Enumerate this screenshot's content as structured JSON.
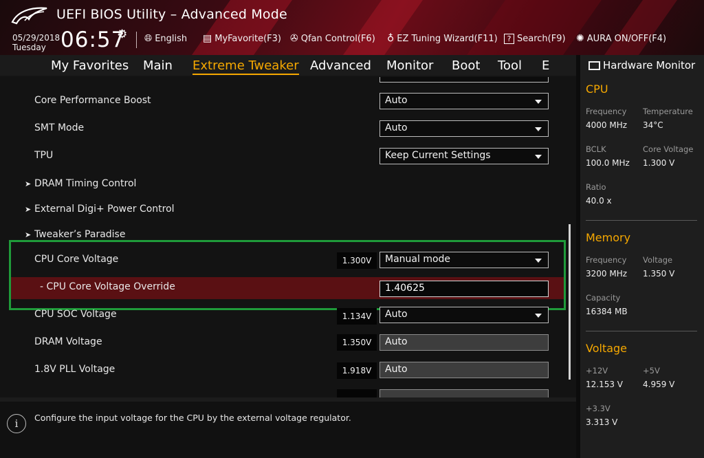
{
  "header": {
    "title": "UEFI BIOS Utility – Advanced Mode",
    "date": "05/29/2018",
    "day": "Tuesday",
    "time": "06:57",
    "tools": [
      {
        "label": "English",
        "icon": "globe-icon"
      },
      {
        "label": "MyFavorite(F3)",
        "icon": "favorite-icon"
      },
      {
        "label": "Qfan Control(F6)",
        "icon": "fan-icon"
      },
      {
        "label": "EZ Tuning Wizard(F11)",
        "icon": "bulb-icon"
      },
      {
        "label": "Search(F9)",
        "icon": "help-search-icon"
      },
      {
        "label": "AURA ON/OFF(F4)",
        "icon": "aura-icon"
      }
    ]
  },
  "nav": {
    "tabs": [
      "My Favorites",
      "Main",
      "Extreme Tweaker",
      "Advanced",
      "Monitor",
      "Boot",
      "Tool",
      "E"
    ],
    "active": "Extreme Tweaker"
  },
  "settings": {
    "core_performance_boost": {
      "label": "Core Performance Boost",
      "value": "Auto"
    },
    "smt_mode": {
      "label": "SMT Mode",
      "value": "Auto"
    },
    "tpu": {
      "label": "TPU",
      "value": "Keep Current Settings"
    },
    "dram_timing": {
      "label": "DRAM Timing Control"
    },
    "digi_power": {
      "label": "External Digi+ Power Control"
    },
    "tweakers_paradise": {
      "label": "Tweaker’s Paradise"
    },
    "cpu_core_voltage": {
      "label": "CPU Core Voltage",
      "reading": "1.300V",
      "value": "Manual mode"
    },
    "cpu_core_voltage_override": {
      "label": "- CPU Core Voltage Override",
      "value": "1.40625"
    },
    "cpu_soc_voltage": {
      "label": "CPU SOC Voltage",
      "reading": "1.134V",
      "value": "Auto"
    },
    "dram_voltage": {
      "label": "DRAM Voltage",
      "reading": "1.350V",
      "value": "Auto"
    },
    "pll_voltage": {
      "label": "1.8V PLL Voltage",
      "reading": "1.918V",
      "value": "Auto"
    }
  },
  "help": {
    "text": "Configure the input voltage for the CPU by the external voltage regulator."
  },
  "monitor": {
    "title": "Hardware Monitor",
    "cpu": {
      "title": "CPU",
      "frequency_label": "Frequency",
      "frequency": "4000 MHz",
      "temperature_label": "Temperature",
      "temperature": "34°C",
      "bclk_label": "BCLK",
      "bclk": "100.0 MHz",
      "core_voltage_label": "Core Voltage",
      "core_voltage": "1.300 V",
      "ratio_label": "Ratio",
      "ratio": "40.0 x"
    },
    "memory": {
      "title": "Memory",
      "frequency_label": "Frequency",
      "frequency": "3200 MHz",
      "voltage_label": "Voltage",
      "voltage": "1.350 V",
      "capacity_label": "Capacity",
      "capacity": "16384 MB"
    },
    "voltage": {
      "title": "Voltage",
      "v12_label": "+12V",
      "v12": "12.153 V",
      "v5_label": "+5V",
      "v5": "4.959 V",
      "v33_label": "+3.3V",
      "v33": "3.313 V"
    }
  },
  "colors": {
    "accent": "#f6a800",
    "selected_row": "#5a1013",
    "highlight_box": "#1f9b3a"
  }
}
